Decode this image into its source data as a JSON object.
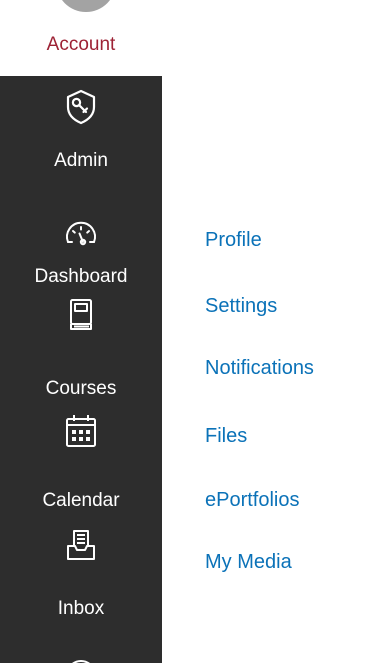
{
  "account": {
    "label": "Account",
    "avatar_icon": "user-avatar"
  },
  "nav": {
    "items": [
      {
        "label": "Admin",
        "icon": "shield-wrench-icon"
      },
      {
        "label": "Dashboard",
        "icon": "speedometer-icon"
      },
      {
        "label": "Courses",
        "icon": "book-icon"
      },
      {
        "label": "Calendar",
        "icon": "calendar-icon"
      },
      {
        "label": "Inbox",
        "icon": "inbox-icon"
      }
    ]
  },
  "tray": {
    "links": [
      {
        "label": "Profile"
      },
      {
        "label": "Settings"
      },
      {
        "label": "Notifications"
      },
      {
        "label": "Files"
      },
      {
        "label": "ePortfolios"
      },
      {
        "label": "My Media"
      }
    ]
  },
  "colors": {
    "nav_background": "#2d2d2d",
    "account_label": "#9d2235",
    "link": "#0b72b8"
  }
}
